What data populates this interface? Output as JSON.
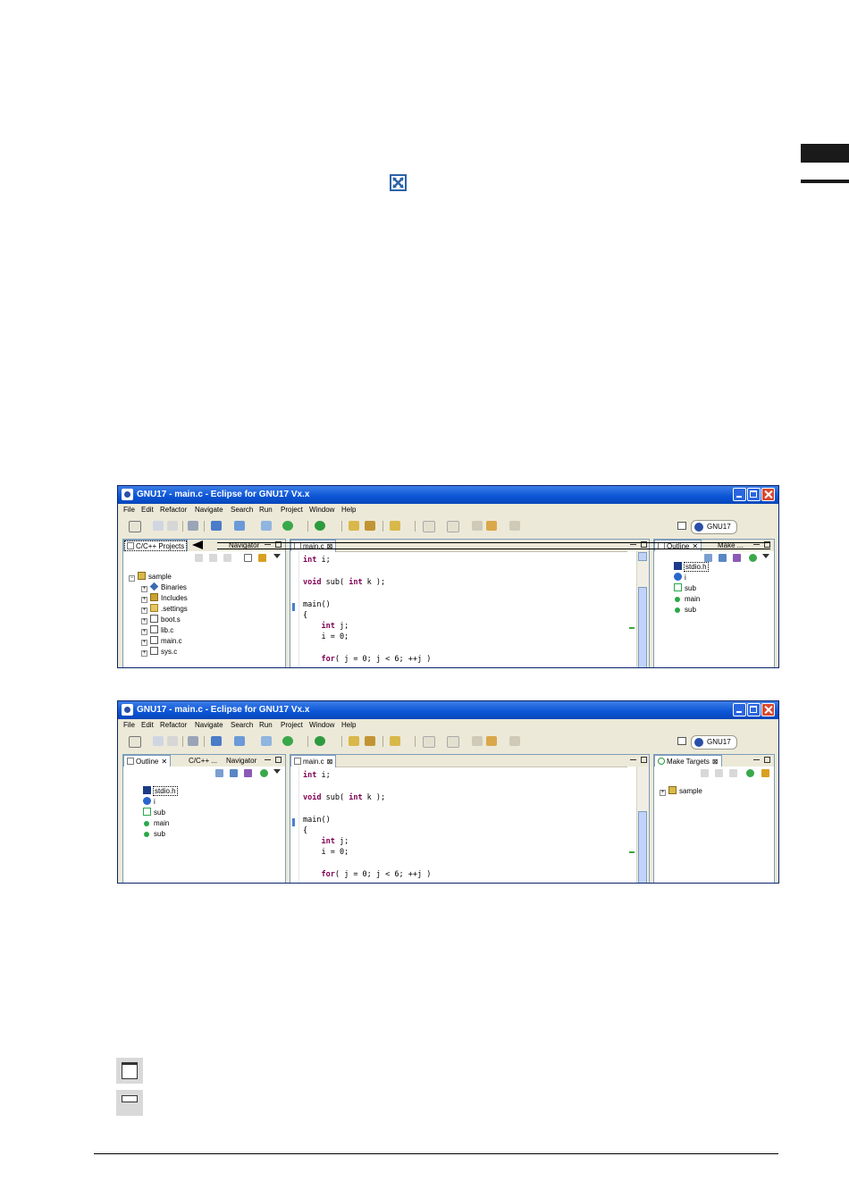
{
  "window_top": {
    "title": "GNU17 - main.c - Eclipse for GNU17 Vx.x",
    "menu": [
      "File",
      "Edit",
      "Refactor",
      "Navigate",
      "Search",
      "Run",
      "Project",
      "Window",
      "Help"
    ],
    "perspective": "GNU17",
    "left_pane": {
      "tabs": [
        "C/C++ Projects",
        "Navigator"
      ],
      "tree": [
        {
          "label": "sample",
          "icon": "project-icon"
        },
        {
          "label": "Binaries",
          "icon": "binaries-icon"
        },
        {
          "label": "Includes",
          "icon": "includes-icon"
        },
        {
          "label": ".settings",
          "icon": "folder-icon"
        },
        {
          "label": "boot.s",
          "icon": "file-icon"
        },
        {
          "label": "lib.c",
          "icon": "file-icon"
        },
        {
          "label": "main.c",
          "icon": "file-icon"
        },
        {
          "label": "sys.c",
          "icon": "file-icon"
        }
      ]
    },
    "editor": {
      "tab": "main.c",
      "lines": [
        "int i;",
        "",
        "void sub( int k );",
        "",
        "main()",
        "{",
        "    int j;",
        "    i = 0;",
        "",
        "    for( j = 0; j < 6; ++j )"
      ]
    },
    "right_pane": {
      "tabs": [
        "Outline",
        "Make ..."
      ],
      "tree": [
        {
          "label": "stdio.h",
          "icon": "header-icon"
        },
        {
          "label": "i",
          "icon": "variable-icon"
        },
        {
          "label": "sub",
          "icon": "function-declaration-icon"
        },
        {
          "label": "main",
          "icon": "function-icon"
        },
        {
          "label": "sub",
          "icon": "function-icon"
        }
      ]
    }
  },
  "window_bottom": {
    "title": "GNU17 - main.c - Eclipse for GNU17 Vx.x",
    "menu": [
      "File",
      "Edit",
      "Refactor",
      "Navigate",
      "Search",
      "Run",
      "Project",
      "Window",
      "Help"
    ],
    "perspective": "GNU17",
    "left_pane": {
      "tabs": [
        "Outline",
        "C/C++ ...",
        "Navigator"
      ],
      "tree": [
        {
          "label": "stdio.h",
          "icon": "header-icon"
        },
        {
          "label": "i",
          "icon": "variable-icon"
        },
        {
          "label": "sub",
          "icon": "function-declaration-icon"
        },
        {
          "label": "main",
          "icon": "function-icon"
        },
        {
          "label": "sub",
          "icon": "function-icon"
        }
      ]
    },
    "editor": {
      "tab": "main.c",
      "lines": [
        "int i;",
        "",
        "void sub( int k );",
        "",
        "main()",
        "{",
        "    int j;",
        "    i = 0;",
        "",
        "    for( j = 0; j < 6; ++j )"
      ]
    },
    "right_pane": {
      "tabs": [
        "Make Targets"
      ],
      "tree": [
        {
          "label": "sample",
          "icon": "project-icon"
        }
      ]
    }
  }
}
